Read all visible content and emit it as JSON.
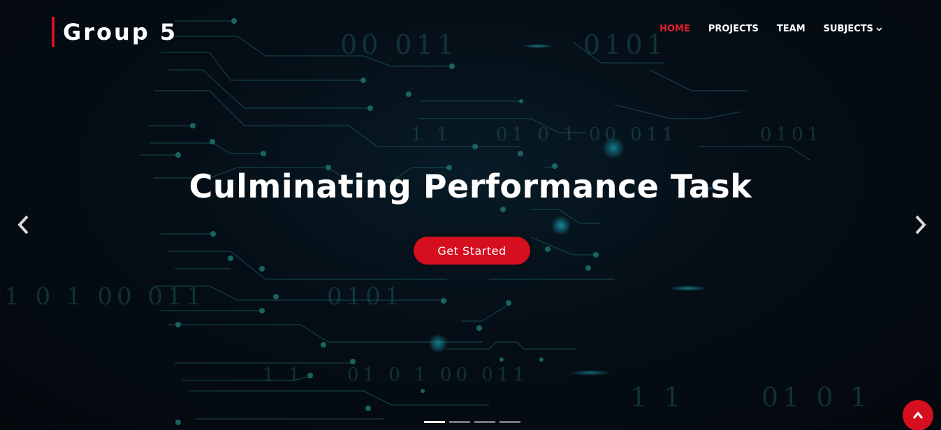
{
  "brand": {
    "name": "Group 5",
    "accent_color": "#d9121f"
  },
  "nav": {
    "items": [
      {
        "label": "HOME",
        "active": true
      },
      {
        "label": "PROJECTS",
        "active": false
      },
      {
        "label": "TEAM",
        "active": false
      },
      {
        "label": "SUBJECTS",
        "active": false,
        "has_dropdown": true
      }
    ]
  },
  "hero": {
    "title": "Culminating Performance Task",
    "cta_label": "Get Started",
    "background_digits": [
      "00  011",
      "0101",
      "1 1",
      "01  0  1  00  011",
      "0101",
      "1  0  1  00  011",
      "0101",
      "1 1",
      "01  0  1  00  011",
      "1 1",
      "01  0  1"
    ]
  },
  "carousel": {
    "slide_count": 4,
    "active_index": 0,
    "prev_icon": "chevron-left-icon",
    "next_icon": "chevron-right-icon"
  },
  "back_to_top": {
    "icon": "chevron-up-icon"
  }
}
